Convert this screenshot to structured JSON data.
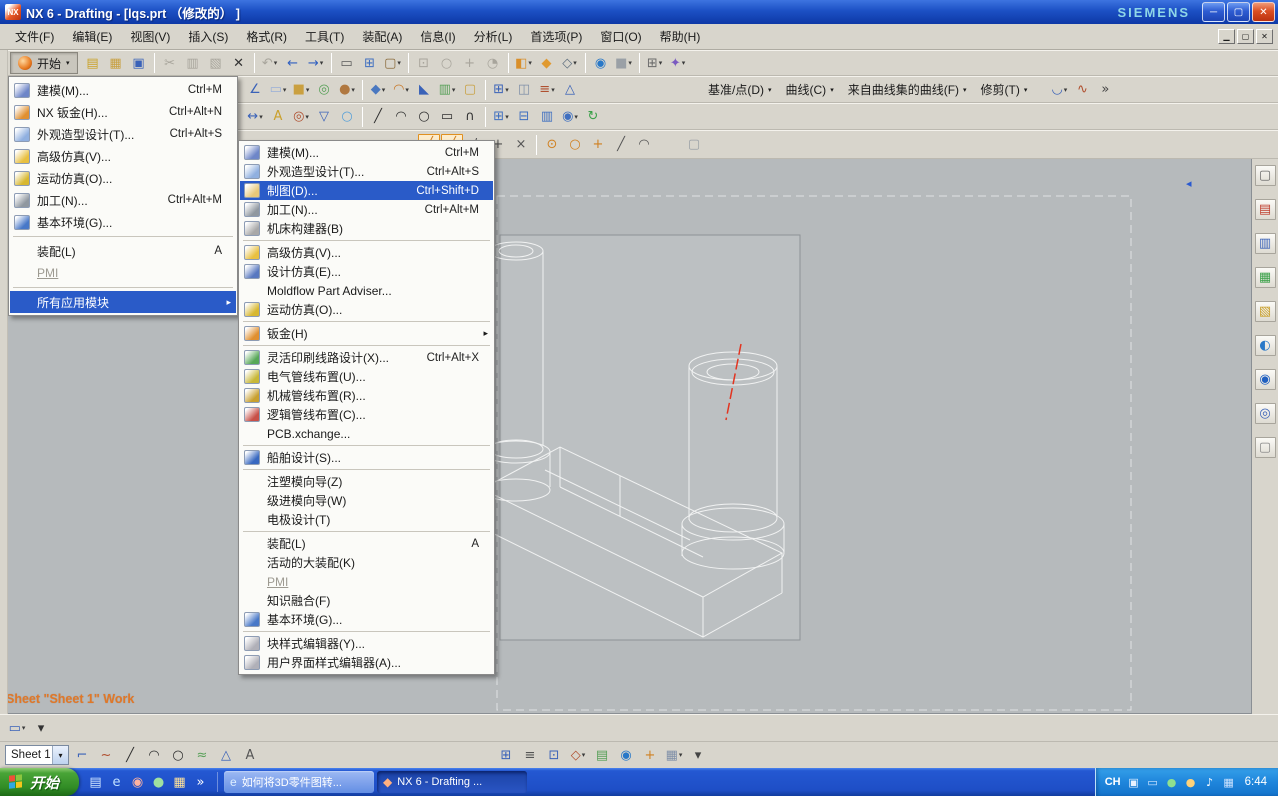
{
  "colors": {
    "menu_highlight": "#2a5bc8",
    "status_label": "#e07828",
    "taskbar_blue": "#2255cf",
    "start_green": "#3f9a31",
    "canvas_gray": "#b6babc",
    "centerline_red": "#e23420"
  },
  "title_bar": {
    "title": "NX 6 - Drafting - [lqs.prt （修改的） ]",
    "brand": "SIEMENS",
    "app_icon_text": "NX",
    "window_buttons": [
      {
        "name": "minimize-button",
        "g": "─"
      },
      {
        "name": "restore-button",
        "g": "▢"
      },
      {
        "name": "close-button",
        "g": "✕",
        "cls": "close"
      }
    ]
  },
  "menu_bar": {
    "items": [
      {
        "label": "文件(F)"
      },
      {
        "label": "编辑(E)"
      },
      {
        "label": "视图(V)"
      },
      {
        "label": "插入(S)"
      },
      {
        "label": "格式(R)"
      },
      {
        "label": "工具(T)"
      },
      {
        "label": "装配(A)"
      },
      {
        "label": "信息(I)"
      },
      {
        "label": "分析(L)"
      },
      {
        "label": "首选项(P)"
      },
      {
        "label": "窗口(O)"
      },
      {
        "label": "帮助(H)"
      }
    ],
    "mdi_buttons": [
      {
        "name": "mdi-minimize-button",
        "g": "▁"
      },
      {
        "name": "mdi-restore-button",
        "g": "▢"
      },
      {
        "name": "mdi-close-button",
        "g": "✕"
      }
    ]
  },
  "toolbars": {
    "row1": {
      "start_label": "开始",
      "icons": [
        {
          "name": "new-part-icon",
          "g": "▤",
          "c": "#caa32a"
        },
        {
          "name": "open-icon",
          "g": "▦",
          "c": "#c8a040"
        },
        {
          "name": "save-icon",
          "g": "▣",
          "c": "#3a62b8"
        },
        {
          "sep": true
        },
        {
          "name": "cut-icon",
          "g": "✂",
          "c": "#8a8a8a",
          "disabled": true
        },
        {
          "name": "copy-icon",
          "g": "▥",
          "c": "#8a8a8a",
          "disabled": true
        },
        {
          "name": "paste-icon",
          "g": "▧",
          "c": "#8a8a8a",
          "disabled": true
        },
        {
          "name": "delete-icon",
          "g": "✕",
          "c": "#333333"
        },
        {
          "sep": true
        },
        {
          "name": "undo-icon",
          "g": "↶",
          "c": "#9a9a9a",
          "disabled": true,
          "dd": true
        },
        {
          "name": "back-icon",
          "g": "←",
          "c": "#2f5fc0"
        },
        {
          "name": "forward-icon",
          "g": "→",
          "c": "#2f5fc0",
          "dd": true
        },
        {
          "sep": true
        },
        {
          "name": "print-icon",
          "g": "▭",
          "c": "#5a5a5a"
        },
        {
          "name": "new-sheet-icon",
          "g": "⊞",
          "c": "#3f6fc0"
        },
        {
          "name": "view-window-icon",
          "g": "▢",
          "c": "#8a6a3a",
          "dd": true
        },
        {
          "sep": true
        },
        {
          "name": "fit-view-icon",
          "g": "⊡",
          "c": "#9a9a9a",
          "disabled": true
        },
        {
          "name": "zoom-icon",
          "g": "○",
          "c": "#9a9a9a",
          "disabled": true
        },
        {
          "name": "pan-icon",
          "g": "+",
          "c": "#9a9a9a",
          "disabled": true
        },
        {
          "name": "rotate-icon",
          "g": "◔",
          "c": "#9a9a9a",
          "disabled": true
        },
        {
          "sep": true
        },
        {
          "name": "render-style-icon",
          "g": "◧",
          "c": "#d98f2a",
          "dd": true
        },
        {
          "name": "shaded-icon",
          "g": "◆",
          "c": "#e09a30"
        },
        {
          "name": "wireframe-icon",
          "g": "◇",
          "c": "#607080",
          "dd": true
        },
        {
          "sep": true
        },
        {
          "name": "globe-icon",
          "g": "◉",
          "c": "#2878c8"
        },
        {
          "name": "hidden-cube-icon",
          "g": "■",
          "c": "#9aa0a6",
          "dd": true
        },
        {
          "sep": true
        },
        {
          "name": "window-tile-icon",
          "g": "⊞",
          "c": "#6a6a6a",
          "dd": true
        },
        {
          "name": "selection-filter-icon",
          "g": "✦",
          "c": "#7a5ac0",
          "dd": true
        }
      ]
    },
    "row2": {
      "icons_left": [
        {
          "name": "sketch-icon",
          "g": "∠",
          "c": "#3a62b8"
        },
        {
          "name": "datum-plane-icon",
          "g": "▭",
          "c": "#9ab0d8",
          "dd": true
        },
        {
          "name": "extrude-icon",
          "g": "■",
          "c": "#caa040",
          "dd": true
        },
        {
          "name": "hole-icon",
          "g": "◎",
          "c": "#58a058"
        },
        {
          "name": "boss-icon",
          "g": "●",
          "c": "#b07840",
          "dd": true
        },
        {
          "sep": true
        },
        {
          "name": "unite-icon",
          "g": "◆",
          "c": "#4a78c0",
          "dd": true
        },
        {
          "name": "edge-blend-icon",
          "g": "◠",
          "c": "#c87828",
          "dd": true
        },
        {
          "name": "chamfer-icon",
          "g": "◣",
          "c": "#3a62b8"
        },
        {
          "name": "trim-body-icon",
          "g": "▥",
          "c": "#58a058",
          "dd": true
        },
        {
          "name": "shell-icon",
          "g": "▢",
          "c": "#c8a040"
        },
        {
          "sep": true
        },
        {
          "name": "instance-icon",
          "g": "⊞",
          "c": "#3a62b8",
          "dd": true
        },
        {
          "name": "mirror-icon",
          "g": "◫",
          "c": "#8090a8"
        },
        {
          "name": "offset-icon",
          "g": "≡",
          "c": "#b05030",
          "dd": true
        },
        {
          "name": "scale-icon",
          "g": "△",
          "c": "#3a62b8"
        }
      ],
      "text_buttons": [
        {
          "name": "datum-point-group-button",
          "label": "基准/点(D)"
        },
        {
          "name": "curve-group-button",
          "label": "曲线(C)"
        },
        {
          "name": "curves-from-curves-group-button",
          "label": "来自曲线集的曲线(F)"
        },
        {
          "name": "trim-group-button",
          "label": "修剪(T)"
        }
      ],
      "icons_right": [
        {
          "name": "surface-icon",
          "g": "◡",
          "c": "#3a62b8",
          "dd": true
        },
        {
          "name": "sweep-icon",
          "g": "∿",
          "c": "#b05030"
        },
        {
          "name": "toolbar-overflow-icon",
          "g": "»",
          "c": "#444444"
        }
      ]
    },
    "row3": {
      "icons": [
        {
          "name": "dimension-icon",
          "g": "↔",
          "c": "#3a62b8",
          "dd": true
        },
        {
          "name": "note-icon",
          "g": "A",
          "c": "#caa02a"
        },
        {
          "name": "id-symbol-icon",
          "g": "◎",
          "c": "#b05030",
          "dd": true
        },
        {
          "name": "datum-feature-icon",
          "g": "▽",
          "c": "#3a62b8"
        },
        {
          "name": "balloon-icon",
          "g": "○",
          "c": "#58a0d8"
        },
        {
          "sep": true
        },
        {
          "name": "line-icon",
          "g": "╱",
          "c": "#303030"
        },
        {
          "name": "arc-icon",
          "g": "◠",
          "c": "#303030"
        },
        {
          "name": "circle-icon",
          "g": "○",
          "c": "#303030"
        },
        {
          "name": "rectangle-icon",
          "g": "▭",
          "c": "#303030"
        },
        {
          "name": "fillet-icon",
          "g": "∩",
          "c": "#303030"
        },
        {
          "sep": true
        },
        {
          "name": "base-view-icon",
          "g": "⊞",
          "c": "#3f6fc0",
          "dd": true
        },
        {
          "name": "projected-view-icon",
          "g": "⊟",
          "c": "#3f6fc0"
        },
        {
          "name": "section-view-icon",
          "g": "▥",
          "c": "#3f6fc0"
        },
        {
          "name": "detail-view-icon",
          "g": "◉",
          "c": "#3f6fc0",
          "dd": true
        },
        {
          "name": "update-views-icon",
          "g": "↻",
          "c": "#3aa048"
        }
      ]
    },
    "row4": {
      "icons": [
        {
          "name": "snap-point-menu-icon",
          "g": "≡",
          "c": "#555555",
          "dd": true
        },
        {
          "gap": 150
        },
        {
          "name": "enable-snap-icon",
          "g": "╱",
          "c": "#d08020",
          "active": true
        },
        {
          "name": "end-point-snap-icon",
          "g": "╱",
          "c": "#d08020",
          "active": true
        },
        {
          "name": "mid-point-snap-icon",
          "g": "/",
          "c": "#555555"
        },
        {
          "name": "control-point-snap-icon",
          "g": "+",
          "c": "#555555"
        },
        {
          "name": "intersection-snap-icon",
          "g": "×",
          "c": "#555555"
        },
        {
          "sep": true
        },
        {
          "name": "arc-center-snap-icon",
          "g": "⊙",
          "c": "#d08020"
        },
        {
          "name": "quadrant-snap-icon",
          "g": "○",
          "c": "#d08020"
        },
        {
          "name": "point-snap-icon",
          "g": "+",
          "c": "#d08020"
        },
        {
          "name": "point-on-curve-snap-icon",
          "g": "╱",
          "c": "#555555"
        },
        {
          "name": "tangent-snap-icon",
          "g": "◠",
          "c": "#555555"
        },
        {
          "gap": 26
        },
        {
          "name": "ghost-cube-icon",
          "g": "▢",
          "c": "#9aa0a6"
        }
      ]
    }
  },
  "start_menu": {
    "items": [
      {
        "name": "modeling",
        "icon": "#6e86c8",
        "label": "建模(M)...",
        "shortcut": "Ctrl+M"
      },
      {
        "name": "nx-sheet-metal",
        "icon": "#e09030",
        "label": "NX 钣金(H)...",
        "shortcut": "Ctrl+Alt+N"
      },
      {
        "name": "shape-studio",
        "icon": "#90b0e0",
        "label": "外观造型设计(T)...",
        "shortcut": "Ctrl+Alt+S"
      },
      {
        "name": "advanced-simulation",
        "icon": "#e8c040",
        "label": "高级仿真(V)..."
      },
      {
        "name": "motion-simulation",
        "icon": "#d8b830",
        "label": "运动仿真(O)..."
      },
      {
        "name": "manufacturing",
        "icon": "#9098a0",
        "label": "加工(N)...",
        "shortcut": "Ctrl+Alt+M"
      },
      {
        "name": "gateway",
        "icon": "#4878c8",
        "label": "基本环境(G)..."
      },
      {
        "sep": true
      },
      {
        "name": "assemblies",
        "label": "装配(L)",
        "shortcut": "A"
      },
      {
        "name": "pmi",
        "label": "PMI",
        "disabled": true
      },
      {
        "sep": true
      },
      {
        "name": "all-applications",
        "label": "所有应用模块",
        "highlight": true,
        "arrow": true
      }
    ]
  },
  "submenu": {
    "items": [
      {
        "name": "modeling",
        "icon": "#6e86c8",
        "label": "建模(M)...",
        "shortcut": "Ctrl+M"
      },
      {
        "name": "shape-studio",
        "icon": "#90b0e0",
        "label": "外观造型设计(T)...",
        "shortcut": "Ctrl+Alt+S"
      },
      {
        "name": "drafting",
        "icon": "#e8c878",
        "label": "制图(D)...",
        "shortcut": "Ctrl+Shift+D",
        "highlight": true
      },
      {
        "name": "manufacturing",
        "icon": "#9098a0",
        "label": "加工(N)...",
        "shortcut": "Ctrl+Alt+M"
      },
      {
        "name": "machine-tool-builder",
        "icon": "#a8a8a8",
        "label": "机床构建器(B)"
      },
      {
        "sep": true
      },
      {
        "name": "advanced-simulation",
        "icon": "#e8c040",
        "label": "高级仿真(V)..."
      },
      {
        "name": "design-simulation",
        "icon": "#5878c0",
        "label": "设计仿真(E)..."
      },
      {
        "name": "moldflow-part-adviser",
        "label": "Moldflow Part Adviser..."
      },
      {
        "name": "motion-simulation",
        "icon": "#d8b830",
        "label": "运动仿真(O)..."
      },
      {
        "sep": true
      },
      {
        "name": "sheet-metal",
        "icon": "#e09030",
        "label": "钣金(H)",
        "arrow": true
      },
      {
        "sep": true
      },
      {
        "name": "flexible-pcb-design",
        "icon": "#58a858",
        "label": "灵活印刷线路设计(X)...",
        "shortcut": "Ctrl+Alt+X"
      },
      {
        "name": "electrical-routing",
        "icon": "#c8b838",
        "label": "电气管线布置(U)..."
      },
      {
        "name": "mechanical-routing",
        "icon": "#c8a030",
        "label": "机械管线布置(R)..."
      },
      {
        "name": "logical-routing",
        "icon": "#c85048",
        "label": "逻辑管线布置(C)..."
      },
      {
        "name": "pcb-xchange",
        "label": "PCB.xchange..."
      },
      {
        "sep": true
      },
      {
        "name": "ship-design",
        "icon": "#3868c0",
        "label": "船舶设计(S)..."
      },
      {
        "sep": true
      },
      {
        "name": "mold-wizard",
        "label": "注塑模向导(Z)"
      },
      {
        "name": "progressive-die-wizard",
        "label": "级进模向导(W)"
      },
      {
        "name": "electrode-design",
        "label": "电极设计(T)"
      },
      {
        "sep": true
      },
      {
        "name": "assemblies",
        "label": "装配(L)",
        "shortcut": "A"
      },
      {
        "name": "large-assemblies",
        "label": "活动的大装配(K)"
      },
      {
        "name": "pmi",
        "label": "PMI",
        "disabled": true
      },
      {
        "name": "knowledge-fusion",
        "label": "知识融合(F)"
      },
      {
        "name": "gateway",
        "icon": "#4878c8",
        "label": "基本环境(G)..."
      },
      {
        "sep": true
      },
      {
        "name": "block-styler",
        "icon": "#b0b0b8",
        "label": "块样式编辑器(Y)..."
      },
      {
        "name": "ui-styler",
        "icon": "#b0b0b8",
        "label": "用户界面样式编辑器(A)..."
      }
    ]
  },
  "canvas": {
    "status_label": "Sheet \"Sheet 1\" Work",
    "collapse_arrow": "◂"
  },
  "right_bar": {
    "icons": [
      {
        "name": "maximize-view-icon",
        "g": "▢",
        "c": "#6a6a6a"
      },
      {
        "name": "assembly-navigator-icon",
        "g": "▤",
        "c": "#c04030"
      },
      {
        "name": "constraint-navigator-icon",
        "g": "▥",
        "c": "#3a62b8"
      },
      {
        "name": "part-navigator-icon",
        "g": "▦",
        "c": "#3aa048"
      },
      {
        "name": "reuse-library-icon",
        "g": "▧",
        "c": "#caa02a"
      },
      {
        "name": "hd3d-tools-icon",
        "g": "◐",
        "c": "#2878c8"
      },
      {
        "name": "web-browser-icon",
        "g": "◉",
        "c": "#2060c0"
      },
      {
        "name": "history-icon",
        "g": "◎",
        "c": "#3a62b8"
      },
      {
        "name": "palettes-icon",
        "g": "▢",
        "c": "#888888"
      }
    ]
  },
  "bottom": {
    "rowA_icons": [
      {
        "name": "measure-tool-icon",
        "g": "▭",
        "c": "#3a62b8",
        "dd": true
      },
      {
        "name": "tool-options-icon",
        "g": "▾",
        "c": "#333333"
      }
    ],
    "sheet_selector": "Sheet 1",
    "rowB_left_icons": [
      {
        "name": "sketch-curve-icon",
        "g": "⌐",
        "c": "#3a62b8"
      },
      {
        "name": "spline-icon",
        "g": "~",
        "c": "#b05030"
      },
      {
        "name": "line-tool-icon",
        "g": "╱",
        "c": "#303030"
      },
      {
        "name": "arc-tool-icon",
        "g": "◠",
        "c": "#303030"
      },
      {
        "name": "circle-tool-icon",
        "g": "○",
        "c": "#303030"
      },
      {
        "name": "studio-spline-icon",
        "g": "≈",
        "c": "#58a058"
      },
      {
        "name": "polygon-icon",
        "g": "△",
        "c": "#3a62b8"
      },
      {
        "name": "text-tool-icon",
        "g": "A",
        "c": "#555555"
      }
    ],
    "rowB_right_icons": [
      {
        "name": "grid-icon",
        "g": "⊞",
        "c": "#3a62b8"
      },
      {
        "name": "align-icon",
        "g": "≡",
        "c": "#555555"
      },
      {
        "name": "snap-grid-icon",
        "g": "⊡",
        "c": "#3a62b8"
      },
      {
        "name": "orient-view-icon",
        "g": "◇",
        "c": "#b05030",
        "dd": true
      },
      {
        "name": "layer-icon",
        "g": "▤",
        "c": "#58a058"
      },
      {
        "name": "visibility-icon",
        "g": "◉",
        "c": "#2878c8"
      },
      {
        "name": "wcs-icon",
        "g": "+",
        "c": "#d08020"
      },
      {
        "name": "object-display-icon",
        "g": "▦",
        "c": "#8090a8",
        "dd": true
      },
      {
        "name": "bottom-overflow-icon",
        "g": "▾",
        "c": "#444444"
      }
    ]
  },
  "taskbar": {
    "start_label": "开始",
    "quick_launch": [
      {
        "name": "show-desktop-icon",
        "g": "▤",
        "c": "#cfe4ff"
      },
      {
        "name": "ie-icon",
        "g": "e",
        "c": "#bfe0ff"
      },
      {
        "name": "media-player-icon",
        "g": "◉",
        "c": "#ffb3a0"
      },
      {
        "name": "messenger-icon",
        "g": "●",
        "c": "#9fe0a0"
      },
      {
        "name": "folder-icon",
        "g": "▦",
        "c": "#ffe29a"
      },
      {
        "name": "quick-launch-overflow-icon",
        "g": "»",
        "c": "#ffffff"
      }
    ],
    "tasks": [
      {
        "name": "task-browser",
        "label": "如何将3D零件图转...",
        "icon_g": "e",
        "icon_c": "#dceeff",
        "cls": "light"
      },
      {
        "name": "task-nx",
        "label": "NX 6 - Drafting ...",
        "icon_g": "◆",
        "icon_c": "#ffb080",
        "cls": "pressed"
      }
    ],
    "tray": {
      "lang": "CH",
      "icons": [
        {
          "name": "ime-icon",
          "g": "▣",
          "c": "#e8f2ff"
        },
        {
          "name": "keyboard-icon",
          "g": "▭",
          "c": "#cfe4ff"
        },
        {
          "name": "antivirus-icon",
          "g": "●",
          "c": "#8fe08f"
        },
        {
          "name": "update-icon",
          "g": "●",
          "c": "#ffd27a"
        },
        {
          "name": "volume-icon",
          "g": "♪",
          "c": "#ffffff"
        },
        {
          "name": "network-icon",
          "g": "▦",
          "c": "#cfe4ff"
        }
      ],
      "time": "6:44"
    }
  }
}
